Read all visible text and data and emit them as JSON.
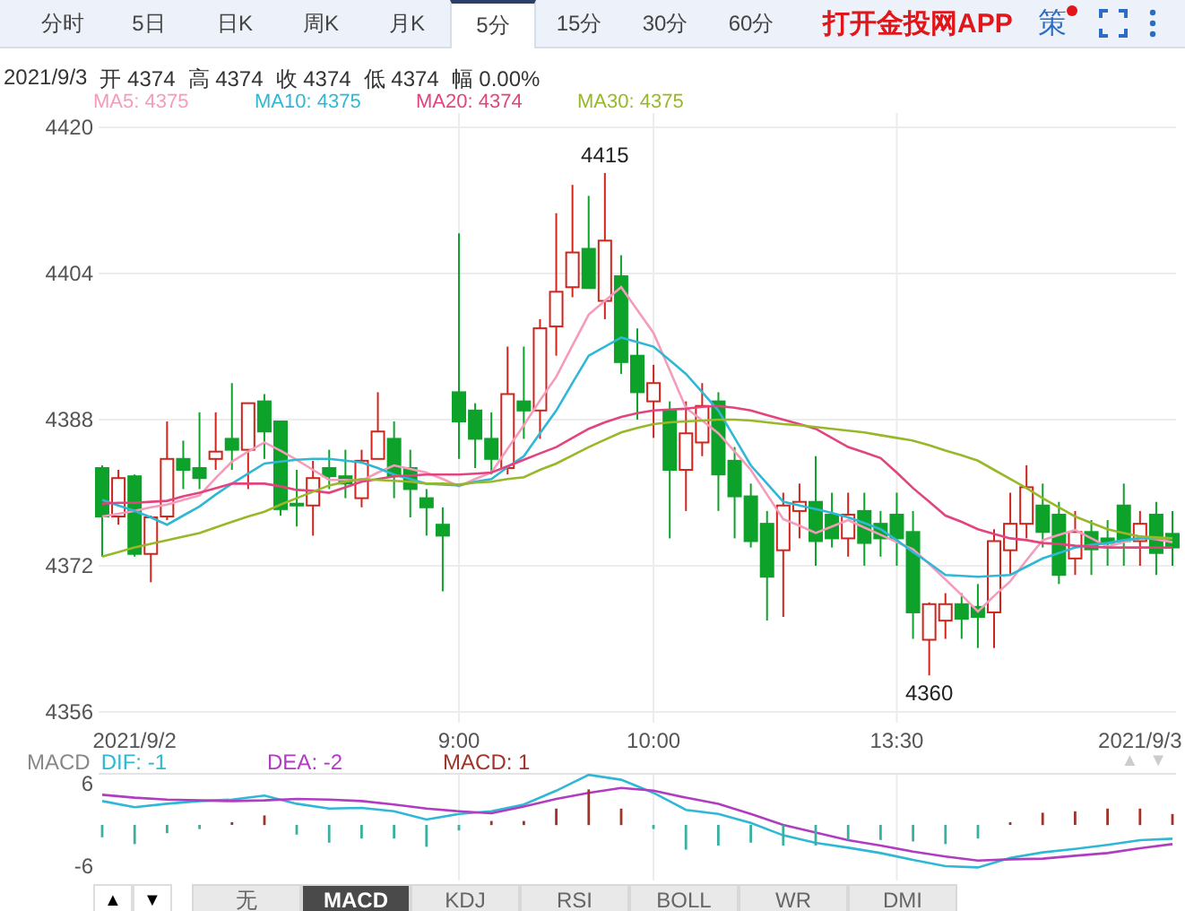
{
  "tabs": [
    {
      "label": "分时",
      "selected": false
    },
    {
      "label": "5日",
      "selected": false
    },
    {
      "label": "日K",
      "selected": false
    },
    {
      "label": "周K",
      "selected": false
    },
    {
      "label": "月K",
      "selected": false
    },
    {
      "label": "5分",
      "selected": true
    },
    {
      "label": "15分",
      "selected": false
    },
    {
      "label": "30分",
      "selected": false
    },
    {
      "label": "60分",
      "selected": false
    }
  ],
  "app_link": "打开金投网APP",
  "strategy": {
    "label": "策"
  },
  "info": {
    "date": "2021/9/3",
    "items": [
      {
        "label": "开",
        "value": "4374"
      },
      {
        "label": "高",
        "value": "4374"
      },
      {
        "label": "收",
        "value": "4374"
      },
      {
        "label": "低",
        "value": "4374"
      },
      {
        "label": "幅",
        "value": "0.00%"
      }
    ]
  },
  "ma_legend": [
    {
      "value": "4375"
    },
    {
      "value": "4375"
    },
    {
      "value": "4374"
    },
    {
      "value": "4375"
    }
  ],
  "price_chart": {
    "chart_data": {
      "type": "candlestick",
      "grid": true,
      "ylim": [
        4356,
        4420
      ],
      "yticks": [
        4356,
        4372,
        4388,
        4404,
        4420
      ],
      "categories": [
        null,
        null,
        "2021/9/2",
        null,
        null,
        null,
        null,
        null,
        null,
        null,
        null,
        null,
        null,
        null,
        null,
        null,
        null,
        null,
        null,
        null,
        null,
        null,
        "9:00",
        null,
        null,
        null,
        null,
        null,
        null,
        null,
        null,
        null,
        null,
        null,
        "10:00",
        null,
        null,
        null,
        null,
        null,
        null,
        null,
        null,
        null,
        null,
        null,
        null,
        null,
        null,
        "13:30",
        null,
        null,
        null,
        null,
        null,
        null,
        null,
        null,
        null,
        null,
        null,
        null,
        null,
        null,
        "2021/9/3",
        null,
        null
      ],
      "ohlc": [
        [
          4382.7,
          4383,
          4373,
          4377.4
        ],
        [
          4377.4,
          4382.5,
          4376.5,
          4381.6
        ],
        [
          4381.8,
          4382,
          4373,
          4373.3
        ],
        [
          4373.3,
          4377.5,
          4370.2,
          4377.3
        ],
        [
          4377.4,
          4387.8,
          4377,
          4383.7
        ],
        [
          4383.7,
          4385.7,
          4380.4,
          4382.5
        ],
        [
          4382.7,
          4388.8,
          4380.4,
          4381.6
        ],
        [
          4383.7,
          4388.8,
          4382.5,
          4384.5
        ],
        [
          4385.9,
          4392,
          4382.5,
          4384.7
        ],
        [
          4384.7,
          4389.8,
          4380.4,
          4389.8
        ],
        [
          4390,
          4390.8,
          4383.7,
          4386.7
        ],
        [
          4387.8,
          4387.8,
          4377.5,
          4378.2
        ],
        [
          4378.8,
          4382.5,
          4376.3,
          4378.6
        ],
        [
          4378.6,
          4383.5,
          4375.3,
          4381.6
        ],
        [
          4382.7,
          4384.7,
          4380.4,
          4381.8
        ],
        [
          4381.8,
          4384.7,
          4379.4,
          4381
        ],
        [
          4379.4,
          4384.7,
          4378.4,
          4383.5
        ],
        [
          4383.7,
          4391,
          4383.7,
          4386.7
        ],
        [
          4385.9,
          4387.8,
          4379.4,
          4381.8
        ],
        [
          4382.7,
          4384.7,
          4377.3,
          4380.4
        ],
        [
          4379.4,
          4380.4,
          4375.3,
          4378.4
        ],
        [
          4376.5,
          4378.4,
          4369.2,
          4375.3
        ],
        [
          4391,
          4408.4,
          4383.7,
          4387.8
        ],
        [
          4389,
          4389.8,
          4382.7,
          4385.9
        ],
        [
          4385.9,
          4388.8,
          4382,
          4383.7
        ],
        [
          4382.7,
          4396,
          4382,
          4390.8
        ],
        [
          4390,
          4396,
          4385.9,
          4389
        ],
        [
          4389,
          4399,
          4385.9,
          4398
        ],
        [
          4398.2,
          4410.6,
          4395,
          4402
        ],
        [
          4402.5,
          4413.7,
          4401.4,
          4406.3
        ],
        [
          4406.7,
          4412.5,
          4402.4,
          4402.4
        ],
        [
          4401,
          4415,
          4399,
          4407.6
        ],
        [
          4403.7,
          4406,
          4393,
          4394.3
        ],
        [
          4395,
          4398,
          4388,
          4391
        ],
        [
          4390,
          4394,
          4386,
          4392
        ],
        [
          4389,
          4390,
          4375,
          4382.5
        ],
        [
          4382.5,
          4390,
          4378,
          4386.5
        ],
        [
          4385.5,
          4392,
          4384,
          4389.5
        ],
        [
          4390,
          4391,
          4378,
          4382
        ],
        [
          4383.5,
          4385,
          4375,
          4379.6
        ],
        [
          4379.6,
          4381,
          4374,
          4374.7
        ],
        [
          4376.6,
          4378,
          4366,
          4370.8
        ],
        [
          4373.7,
          4380,
          4366.4,
          4378.6
        ],
        [
          4378,
          4381,
          4375,
          4379
        ],
        [
          4379,
          4384,
          4372,
          4374.7
        ],
        [
          4377.6,
          4380,
          4374,
          4375
        ],
        [
          4375,
          4380,
          4373,
          4377.6
        ],
        [
          4378,
          4380,
          4372,
          4374.5
        ],
        [
          4376.6,
          4378,
          4373,
          4375
        ],
        [
          4377.6,
          4380,
          4372,
          4375
        ],
        [
          4375.7,
          4378,
          4364,
          4366.9
        ],
        [
          4363.9,
          4368,
          4360,
          4367.8
        ],
        [
          4366,
          4369,
          4364,
          4367.8
        ],
        [
          4367.8,
          4369,
          4364,
          4366.2
        ],
        [
          4367.5,
          4370,
          4363,
          4366.4
        ],
        [
          4366.9,
          4376,
          4363,
          4374.7
        ],
        [
          4373.7,
          4380,
          4371,
          4376.6
        ],
        [
          4376.6,
          4383,
          4375,
          4380.6
        ],
        [
          4378.6,
          4381,
          4374,
          4375.7
        ],
        [
          4377.6,
          4379,
          4370,
          4371
        ],
        [
          4372.8,
          4378,
          4371,
          4375.7
        ],
        [
          4375.7,
          4377,
          4371,
          4373.8
        ],
        [
          4375,
          4377,
          4372,
          4374.5
        ],
        [
          4378.6,
          4381,
          4372,
          4374.7
        ],
        [
          4374.7,
          4378,
          4372,
          4376.6
        ],
        [
          4377.6,
          4379,
          4371,
          4373.4
        ],
        [
          4375.5,
          4378,
          4372,
          4374
        ]
      ],
      "series": [
        {
          "name": "MA5:",
          "color": "#f59bbb",
          "type": "line",
          "values": [
            4377.4,
            4377.7,
            4378,
            4378.4,
            4378.7,
            4379.2,
            4379.7,
            4381.6,
            4383.4,
            4384.5,
            4385.5,
            4384.6,
            4383.6,
            4382.5,
            4381.4,
            4381.4,
            4381.3,
            4382.2,
            4383,
            4382.6,
            4382.2,
            4381.5,
            4380.7,
            4381.5,
            4382.2,
            4384.8,
            4387.4,
            4390.1,
            4392.7,
            4396.1,
            4399.5,
            4401,
            4402.5,
            4400,
            4397.5,
            4393.4,
            4389.3,
            4387.9,
            4386.5,
            4384.5,
            4382.5,
            4379.8,
            4377.1,
            4376.4,
            4375.6,
            4376.3,
            4377,
            4376.2,
            4375.4,
            4374.6,
            4373.8,
            4372.2,
            4370.5,
            4368.8,
            4367,
            4368.7,
            4370.3,
            4372.6,
            4374.8,
            4375.4,
            4375.9,
            4375,
            4374.1,
            4374.6,
            4375.1,
            4374.9,
            4374.6
          ]
        },
        {
          "name": "MA10:",
          "color": "#2fb8d6",
          "type": "line",
          "values": [
            4379.2,
            4378.6,
            4378,
            4377.3,
            4376.5,
            4377.5,
            4378.5,
            4379.8,
            4381,
            4382.1,
            4383.2,
            4383.4,
            4383.6,
            4383.7,
            4383.7,
            4383.5,
            4383.3,
            4382.7,
            4382,
            4381.5,
            4381,
            4380.9,
            4380.8,
            4381.2,
            4381.5,
            4382.8,
            4384,
            4386.5,
            4389,
            4392,
            4395,
            4396,
            4397,
            4396.5,
            4396,
            4394.5,
            4393,
            4391,
            4389,
            4386,
            4383,
            4381,
            4379,
            4378.6,
            4378.2,
            4377.8,
            4377.3,
            4376.7,
            4376,
            4374.8,
            4373.5,
            4372.3,
            4371,
            4370.9,
            4370.8,
            4370.9,
            4371,
            4371.9,
            4372.8,
            4373.4,
            4374,
            4374.3,
            4374.5,
            4374.8,
            4375,
            4375,
            4375
          ]
        },
        {
          "name": "MA20:",
          "color": "#e2447f",
          "type": "line",
          "values": [
            4378.8,
            4378.9,
            4378.9,
            4379,
            4379.1,
            4379.6,
            4380,
            4380.5,
            4381,
            4381,
            4381,
            4380.7,
            4380.3,
            4380.2,
            4380,
            4380.6,
            4381.2,
            4381.5,
            4381.8,
            4381.9,
            4382,
            4382,
            4382,
            4382.1,
            4382.2,
            4382.9,
            4383.6,
            4384.3,
            4385,
            4386,
            4387,
            4387.7,
            4388.3,
            4388.7,
            4389,
            4389.1,
            4389.2,
            4389.4,
            4389.5,
            4389.3,
            4389,
            4388.5,
            4388,
            4387.5,
            4387,
            4386,
            4385,
            4384.4,
            4383.8,
            4382.2,
            4380.5,
            4379,
            4377.5,
            4376.8,
            4376,
            4375.5,
            4375,
            4374.8,
            4374.5,
            4374.4,
            4374.2,
            4374.1,
            4374,
            4374,
            4374,
            4374,
            4374
          ]
        },
        {
          "name": "MA30:",
          "color": "#98b82a",
          "type": "line",
          "values": [
            4373,
            4373.5,
            4374,
            4374.4,
            4374.8,
            4375.2,
            4375.6,
            4376.2,
            4376.8,
            4377.4,
            4377.9,
            4378.7,
            4379.4,
            4380.1,
            4380.8,
            4381.2,
            4381.5,
            4381.4,
            4381.3,
            4381.2,
            4381,
            4381,
            4380.9,
            4381.1,
            4381.2,
            4381.5,
            4381.7,
            4382.5,
            4383.2,
            4384.1,
            4385,
            4385.8,
            4386.6,
            4387.1,
            4387.5,
            4387.7,
            4387.8,
            4387.9,
            4388,
            4388,
            4387.9,
            4387.7,
            4387.5,
            4387.4,
            4387.2,
            4387,
            4386.8,
            4386.6,
            4386.3,
            4386,
            4385.7,
            4385.2,
            4384.6,
            4384.1,
            4383.5,
            4382.5,
            4381.5,
            4380.5,
            4379.4,
            4378.4,
            4377.4,
            4376.7,
            4376,
            4375.6,
            4375.2,
            4375.1,
            4375
          ]
        }
      ],
      "annotations": [
        "4415",
        "4360"
      ]
    }
  },
  "macd_legend": {
    "title": "MACD",
    "items": [
      {
        "value": "-1"
      },
      {
        "value": "-2"
      },
      {
        "value": "1"
      }
    ],
    "arrows": [
      "▲",
      "▼"
    ]
  },
  "macd_chart": {
    "chart_data": {
      "type": "line",
      "grid": true,
      "ylim": [
        -8.1,
        7.6
      ],
      "yticks": [
        -6,
        6
      ],
      "categories": [
        null,
        null,
        null,
        null,
        null,
        null,
        null,
        null,
        null,
        null,
        null,
        null,
        null,
        null,
        null,
        null,
        null,
        null,
        null,
        null,
        null,
        null,
        null,
        null,
        null,
        null,
        null,
        null,
        null,
        null,
        null,
        null,
        null,
        null
      ],
      "series": [
        {
          "name": "DIF:",
          "color": "#2fb8d6",
          "values": [
            3.5,
            2.6,
            3.1,
            3.5,
            3.7,
            4.3,
            3.1,
            2.4,
            2.5,
            2.0,
            0.8,
            1.6,
            2.0,
            3.0,
            5.0,
            7.3,
            6.6,
            4.7,
            2.2,
            1.6,
            0.3,
            -1.5,
            -2.6,
            -3.3,
            -4.1,
            -5.1,
            -6.0,
            -6.2,
            -4.8,
            -4.0,
            -3.5,
            -2.9,
            -2.2,
            -2.0
          ]
        },
        {
          "name": "DEA:",
          "color": "#b03cc0",
          "values": [
            4.4,
            4.0,
            3.7,
            3.6,
            3.5,
            3.6,
            3.8,
            3.7,
            3.5,
            3.0,
            2.4,
            2.0,
            1.7,
            2.7,
            3.8,
            4.7,
            5.4,
            5.0,
            4.0,
            3.1,
            1.6,
            0,
            -1.1,
            -2.2,
            -3.0,
            -3.9,
            -4.6,
            -5.2,
            -5.0,
            -4.9,
            -4.5,
            -4.1,
            -3.4,
            -2.8
          ]
        },
        {
          "name": "MACD:",
          "color": "#a0342a",
          "type": "bar",
          "values": [
            null,
            null,
            null,
            null,
            0.4,
            1.4,
            null,
            null,
            null,
            null,
            null,
            null,
            0.6,
            0.6,
            2.4,
            5.2,
            2.4,
            null,
            null,
            null,
            null,
            null,
            null,
            null,
            null,
            null,
            null,
            null,
            0.4,
            1.8,
            2.0,
            2.4,
            2.4,
            1.6
          ]
        },
        {
          "color": "#3cb0a0",
          "type": "bar",
          "values": [
            -1.8,
            -2.8,
            -1.2,
            -0.6,
            null,
            null,
            -1.4,
            -2.6,
            -2.0,
            -2.0,
            -3.2,
            -0.8,
            null,
            null,
            null,
            null,
            null,
            -0.6,
            -3.6,
            -3.0,
            -2.6,
            -3.0,
            -3.0,
            -2.2,
            -2.2,
            -2.4,
            -2.8,
            -2.0,
            null,
            null,
            null,
            null,
            null,
            null
          ]
        }
      ]
    }
  },
  "bottom_bar": {
    "arrows": [
      "▲",
      "▼"
    ],
    "indicators": [
      {
        "label": "无",
        "selected": false
      },
      {
        "label": "MACD",
        "selected": true
      },
      {
        "label": "KDJ",
        "selected": false
      },
      {
        "label": "RSI",
        "selected": false
      },
      {
        "label": "BOLL",
        "selected": false
      },
      {
        "label": "WR",
        "selected": false
      },
      {
        "label": "DMI",
        "selected": false
      }
    ]
  }
}
